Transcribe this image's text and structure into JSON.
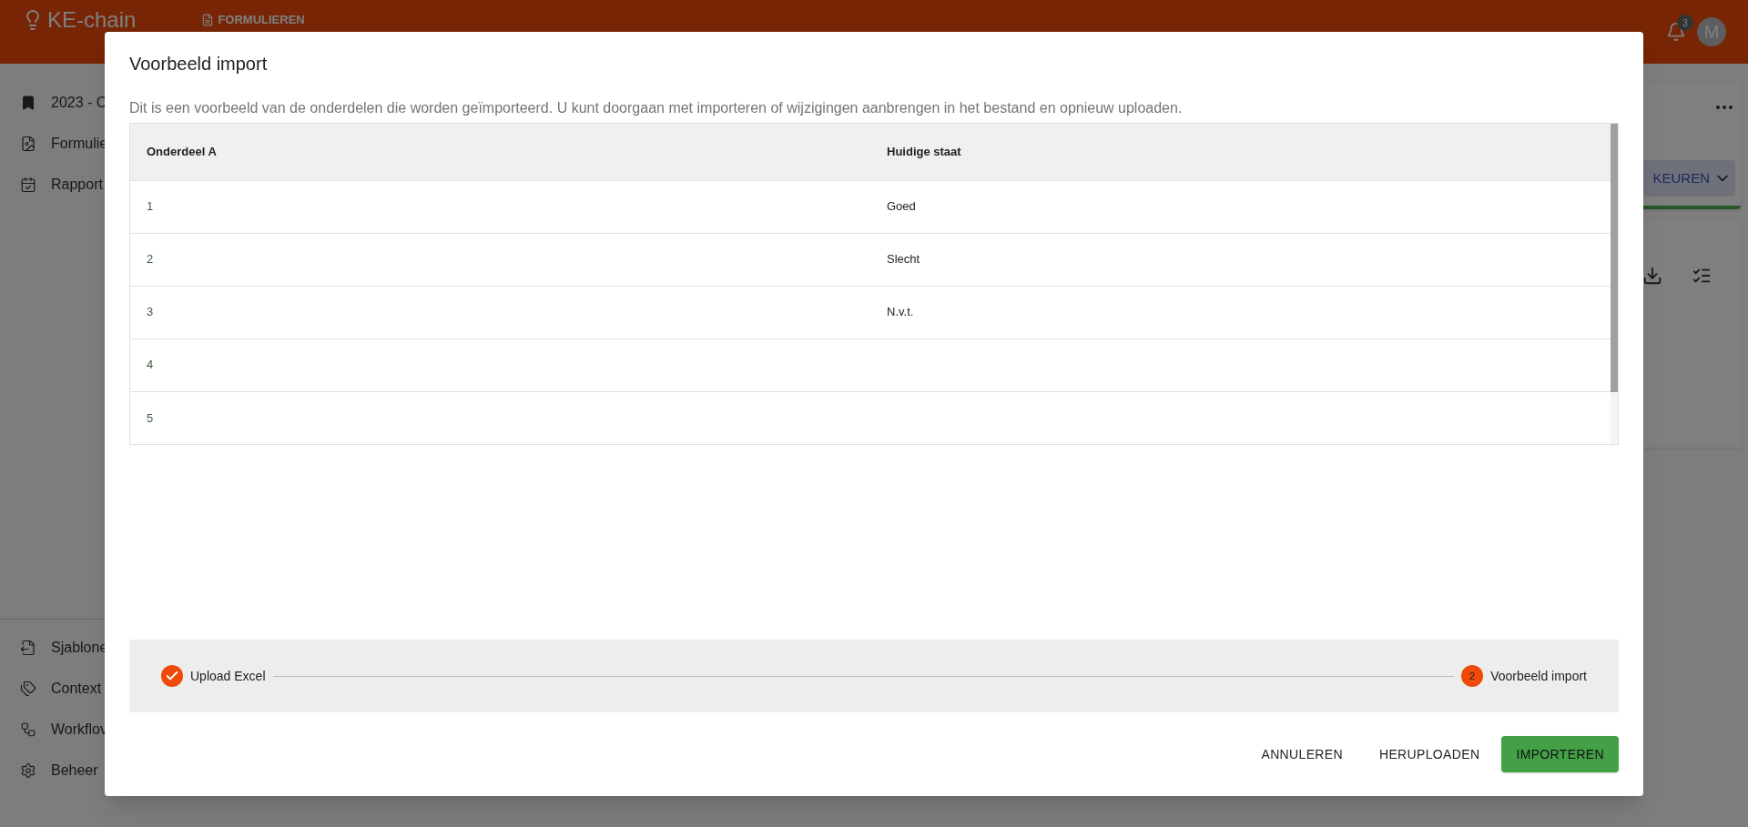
{
  "topbar": {
    "logo": "KE-chain",
    "nav": "FORMULIEREN",
    "notifications": "3",
    "avatar": "M"
  },
  "sidebar": {
    "items": [
      {
        "label": "2023 - C",
        "kind": "bookmark"
      },
      {
        "label": "Formulie",
        "kind": "form"
      },
      {
        "label": "Rapport",
        "kind": "report"
      }
    ],
    "bottom_items": [
      {
        "label": "Sjablone",
        "kind": "export"
      },
      {
        "label": "Context",
        "kind": "tags"
      },
      {
        "label": "Workflov",
        "kind": "workflow"
      },
      {
        "label": "Beheer",
        "kind": "settings"
      }
    ]
  },
  "background": {
    "approve_button": "KEUREN"
  },
  "dialog": {
    "title": "Voorbeeld import",
    "description": "Dit is een voorbeeld van de onderdelen die worden geïmporteerd. U kunt doorgaan met importeren of wijzigingen aanbrengen in het bestand en opnieuw uploaden.",
    "table": {
      "columns": [
        "Onderdeel A",
        "Huidige staat"
      ],
      "rows": [
        [
          "1",
          "Goed"
        ],
        [
          "2",
          "Slecht"
        ],
        [
          "3",
          "N.v.t."
        ],
        [
          "4",
          ""
        ],
        [
          "5",
          ""
        ]
      ]
    },
    "steps": [
      {
        "label": "Upload Excel",
        "completed": true
      },
      {
        "label": "Voorbeeld import",
        "number": "2",
        "completed": false
      }
    ],
    "buttons": [
      {
        "label": "ANNULEREN",
        "kind": "text"
      },
      {
        "label": "HERUPLOADEN",
        "kind": "text"
      },
      {
        "label": "IMPORTEREN",
        "kind": "primary"
      }
    ]
  }
}
